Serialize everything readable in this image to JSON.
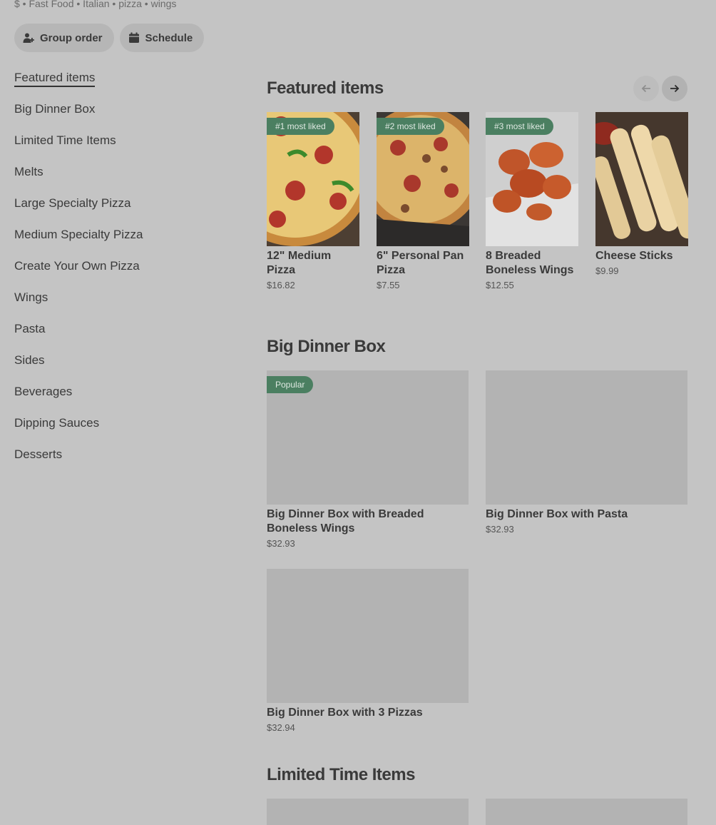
{
  "header": {
    "tagline": "$ • Fast Food • Italian • pizza • wings",
    "group_order_label": "Group order",
    "schedule_label": "Schedule"
  },
  "sidebar": {
    "items": [
      {
        "label": "Featured items"
      },
      {
        "label": "Big Dinner Box"
      },
      {
        "label": "Limited Time Items"
      },
      {
        "label": "Melts"
      },
      {
        "label": "Large Specialty Pizza"
      },
      {
        "label": "Medium Specialty Pizza"
      },
      {
        "label": "Create Your Own Pizza"
      },
      {
        "label": "Wings"
      },
      {
        "label": "Pasta"
      },
      {
        "label": "Sides"
      },
      {
        "label": "Beverages"
      },
      {
        "label": "Dipping Sauces"
      },
      {
        "label": "Desserts"
      }
    ]
  },
  "featured": {
    "title": "Featured items",
    "items": [
      {
        "badge": "#1 most liked",
        "name": "12\" Medium Pizza",
        "price": "$16.82"
      },
      {
        "badge": "#2 most liked",
        "name": "6\" Personal Pan Pizza",
        "price": "$7.55"
      },
      {
        "badge": "#3 most liked",
        "name": "8 Breaded Boneless Wings",
        "price": "$12.55"
      },
      {
        "badge": "",
        "name": "Cheese Sticks",
        "price": "$9.99"
      }
    ]
  },
  "big_dinner_box": {
    "title": "Big Dinner Box",
    "items": [
      {
        "badge": "Popular",
        "name": "Big Dinner Box with Breaded Boneless Wings",
        "price": "$32.93"
      },
      {
        "badge": "",
        "name": "Big Dinner Box with Pasta",
        "price": "$32.93"
      },
      {
        "badge": "",
        "name": "Big Dinner Box with 3 Pizzas",
        "price": "$32.94"
      }
    ]
  },
  "limited_time": {
    "title": "Limited Time Items"
  },
  "colors": {
    "background": "#c4c4c4",
    "badge": "#4b7f61",
    "placeholder": "#b3b3b3"
  }
}
